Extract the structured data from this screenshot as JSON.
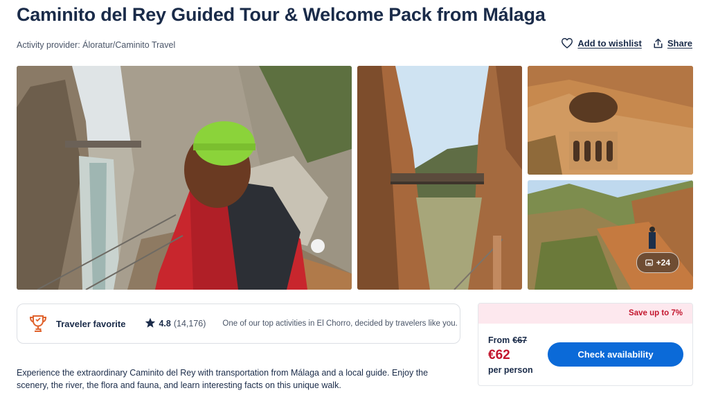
{
  "header": {
    "title": "Caminito del Rey Guided Tour & Welcome Pack from Málaga",
    "provider": "Activity provider: Áloratur/Caminito Travel",
    "wishlist_label": "Add to wishlist",
    "share_label": "Share"
  },
  "gallery": {
    "more_count": "+24"
  },
  "badge": {
    "label": "Traveler favorite",
    "rating": "4.8",
    "reviews": "(14,176)",
    "description": "One of our top activities in El Chorro, decided by travelers like you."
  },
  "pricing": {
    "save_text": "Save up to 7%",
    "from_label": "From",
    "old_price": "€67",
    "price": "€62",
    "per_person": "per person",
    "cta_label": "Check availability"
  },
  "description": "Experience the extraordinary Caminito del Rey with transportation from Málaga and a local guide. Enjoy the scenery, the river, the flora and fauna, and learn interesting facts on this unique walk.",
  "colors": {
    "navy": "#1a2b49",
    "brand_blue": "#0b6ad8",
    "sale_red": "#c3162e",
    "sale_bg": "#fde8ee",
    "award_orange": "#e0632d"
  },
  "icons": {
    "wishlist": "heart-icon",
    "share": "share-icon",
    "award": "trophy-icon",
    "rating": "star-icon",
    "gallery": "image-icon"
  }
}
